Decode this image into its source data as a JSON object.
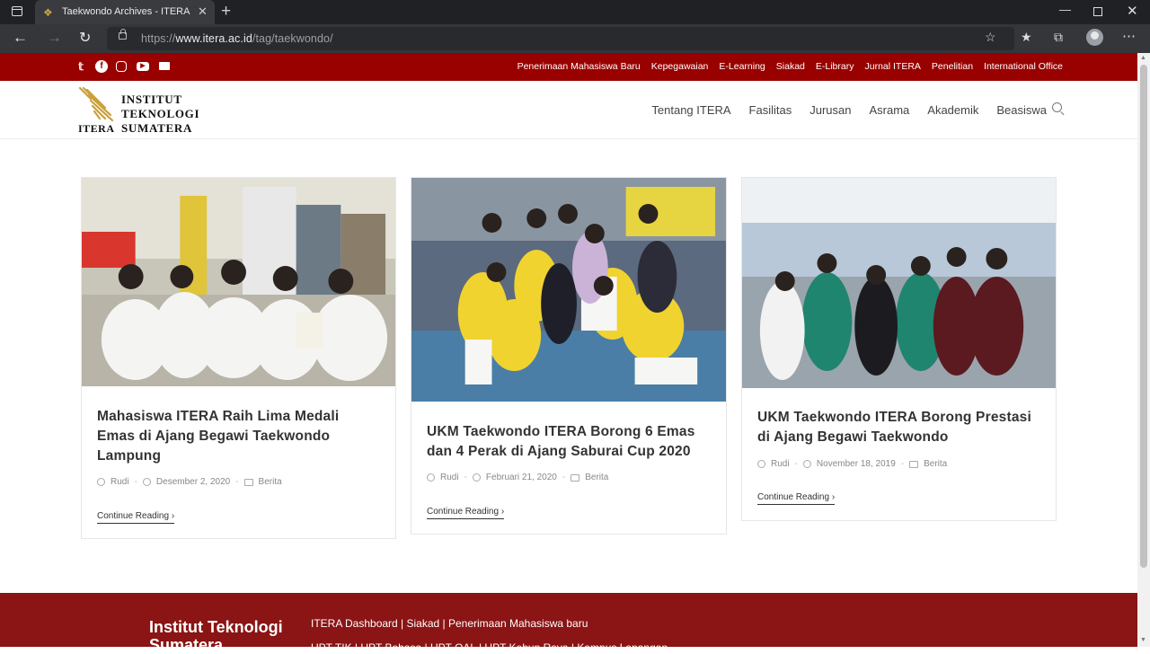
{
  "browser": {
    "tab_title": "Taekwondo Archives - ITERA",
    "url_prefix": "https://",
    "url_domain": "www.itera.ac.id",
    "url_path": "/tag/taekwondo/"
  },
  "topbar": {
    "links": [
      "Penerimaan Mahasiswa Baru",
      "Kepegawaian",
      "E-Learning",
      "Siakad",
      "E-Library",
      "Jurnal ITERA",
      "Penelitian",
      "International Office"
    ]
  },
  "logo": {
    "line1": "INSTITUT",
    "line2": "TEKNOLOGI",
    "line3": "SUMATERA",
    "short": "ITERA"
  },
  "nav": {
    "items": [
      "Tentang ITERA",
      "Fasilitas",
      "Jurusan",
      "Asrama",
      "Akademik",
      "Beasiswa"
    ]
  },
  "posts": [
    {
      "title": "Mahasiswa ITERA Raih Lima Medali Emas di Ajang Begawi Taekwondo Lampung",
      "author": "Rudi",
      "date": "Desember 2, 2020",
      "category": "Berita",
      "read_more": "Continue Reading"
    },
    {
      "title": "UKM Taekwondo ITERA Borong 6 Emas dan 4 Perak di Ajang Saburai Cup 2020",
      "author": "Rudi",
      "date": "Februari 21, 2020",
      "category": "Berita",
      "read_more": "Continue Reading"
    },
    {
      "title": "UKM Taekwondo ITERA Borong Prestasi di Ajang Begawi Taekwondo",
      "author": "Rudi",
      "date": "November 18, 2019",
      "category": "Berita",
      "read_more": "Continue Reading"
    }
  ],
  "footer": {
    "title": "Institut Teknologi Sumatera",
    "links": "ITERA Dashboard | Siakad | Penerimaan Mahasiswa baru",
    "links2": "UPT TIK | UPT Bahasa | UPT OAL | UPT Kebun Raya | Kampus Lapangan"
  },
  "colors": {
    "brand_red": "#990000",
    "footer_red": "#8b1414"
  },
  "icons": [
    "twitter-icon",
    "facebook-icon",
    "instagram-icon",
    "youtube-icon",
    "email-icon"
  ]
}
